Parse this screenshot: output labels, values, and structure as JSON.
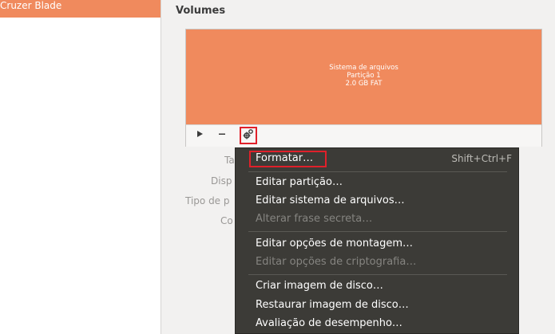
{
  "sidebar": {
    "items": [
      {
        "label": "Cruzer Blade"
      }
    ]
  },
  "main": {
    "section_title": "Volumes",
    "partition": {
      "line1": "Sistema de arquivos",
      "line2": "Partição 1",
      "line3": "2.0 GB FAT"
    },
    "toolbar": {
      "play_icon": "play-icon",
      "minus_icon": "minus-icon",
      "gear_icon": "gear-icon"
    },
    "labels": [
      "Ta",
      "Disp",
      "Tipo de p",
      "Co"
    ]
  },
  "menu": {
    "items": [
      {
        "label": "Formatar…",
        "shortcut": "Shift+Ctrl+F",
        "disabled": false
      },
      {
        "label": "Editar partição…",
        "disabled": false
      },
      {
        "label": "Editar sistema de arquivos…",
        "disabled": false
      },
      {
        "label": "Alterar frase secreta…",
        "disabled": true
      },
      {
        "label": "Editar opções de montagem…",
        "disabled": false
      },
      {
        "label": "Editar opções de criptografia…",
        "disabled": true
      },
      {
        "label": "Criar imagem de disco…",
        "disabled": false
      },
      {
        "label": "Restaurar imagem de disco…",
        "disabled": false
      },
      {
        "label": "Avaliação de desempenho…",
        "disabled": false
      }
    ]
  },
  "colors": {
    "accent": "#f08a5d",
    "menu_bg": "#3c3b37",
    "highlight": "#e0202a"
  }
}
